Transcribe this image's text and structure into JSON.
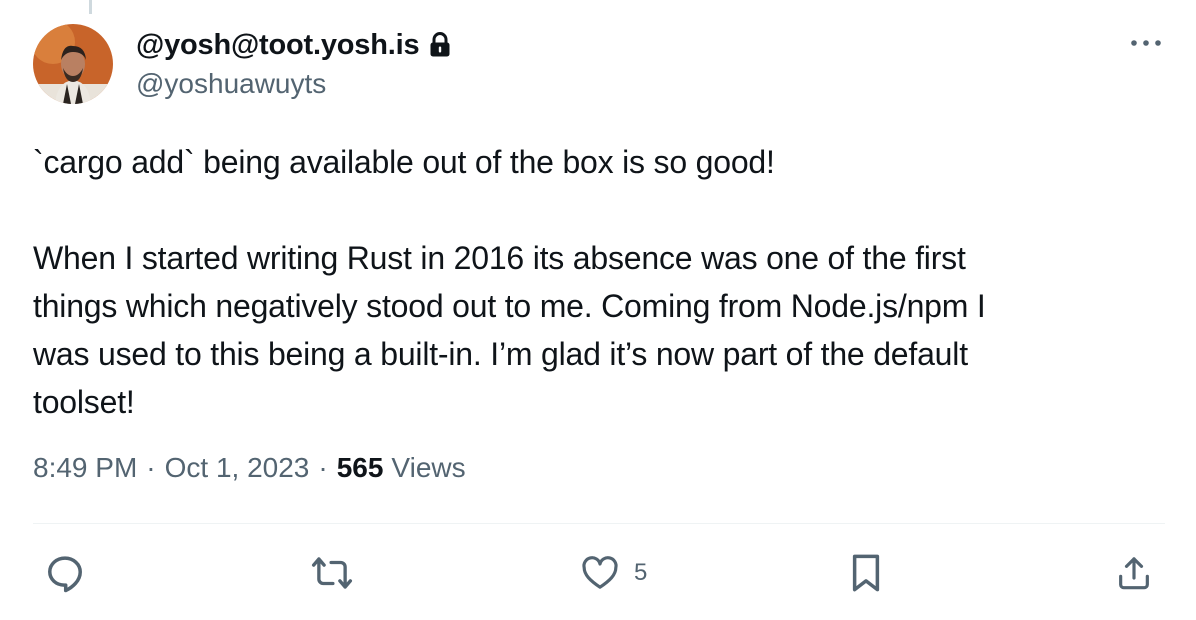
{
  "tweet": {
    "display_name": "@yosh@toot.yosh.is",
    "handle": "@yoshuawuyts",
    "text_paragraph_1": "`cargo add` being available out of the box is so good!",
    "text_paragraph_2_line_1": "When I started writing Rust in 2016 its absence was one of the first",
    "text_paragraph_2_line_2": "things which negatively stood out to me. Coming from Node.js/npm I",
    "text_paragraph_2_line_3": "was used to this being a built-in. I’m glad it’s now part of the default",
    "text_paragraph_2_line_4": "toolset!",
    "time": "8:49 PM",
    "separator": "·",
    "date": "Oct 1, 2023",
    "views_count": "565",
    "views_label": "Views"
  },
  "actions": {
    "like_count": "5"
  },
  "icons": {
    "lock": "lock-icon",
    "more": "more-icon",
    "reply": "reply-icon",
    "retweet": "retweet-icon",
    "like": "heart-icon",
    "bookmark": "bookmark-icon",
    "share": "share-icon"
  },
  "colors": {
    "text_primary": "#0f1419",
    "text_secondary": "#536471",
    "divider": "#eff3f4",
    "thread_line": "#cfd9de"
  }
}
